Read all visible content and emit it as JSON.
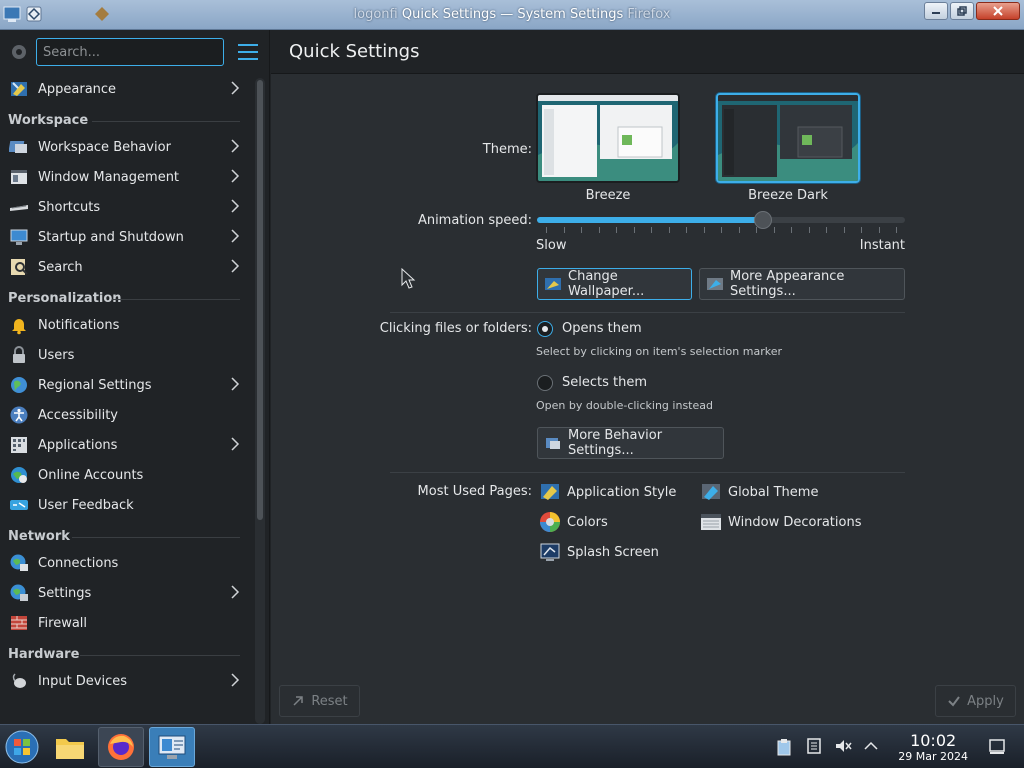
{
  "window": {
    "title_ghost_left": "logonfi",
    "title": "Quick Settings — System Settings",
    "title_ghost_right": "Firefox"
  },
  "sidebar": {
    "search_placeholder": "Search...",
    "appearance": "Appearance",
    "sections": {
      "workspace": "Workspace",
      "personalization": "Personalization",
      "network": "Network",
      "hardware": "Hardware"
    },
    "items": {
      "workspace_behavior": "Workspace Behavior",
      "window_management": "Window Management",
      "shortcuts": "Shortcuts",
      "startup_shutdown": "Startup and Shutdown",
      "search": "Search",
      "notifications": "Notifications",
      "users": "Users",
      "regional_settings": "Regional Settings",
      "accessibility": "Accessibility",
      "applications": "Applications",
      "online_accounts": "Online Accounts",
      "user_feedback": "User Feedback",
      "connections": "Connections",
      "settings": "Settings",
      "firewall": "Firewall",
      "input_devices": "Input Devices"
    }
  },
  "main": {
    "title": "Quick Settings",
    "theme_label": "Theme:",
    "themes": [
      "Breeze",
      "Breeze Dark"
    ],
    "selected_theme": "Breeze Dark",
    "animation_label": "Animation speed:",
    "animation_speed": 0.62,
    "slow_label": "Slow",
    "instant_label": "Instant",
    "change_wallpaper": "Change Wallpaper...",
    "more_appearance": "More Appearance Settings...",
    "clicking_label": "Clicking files or folders:",
    "opens_them": "Opens them",
    "opens_hint": "Select by clicking on item's selection marker",
    "selects_them": "Selects them",
    "selects_hint": "Open by double-clicking instead",
    "more_behavior": "More Behavior Settings...",
    "most_used_label": "Most Used Pages:",
    "most_used": {
      "application_style": "Application Style",
      "global_theme": "Global Theme",
      "colors": "Colors",
      "window_decorations": "Window Decorations",
      "splash_screen": "Splash Screen"
    },
    "reset": "Reset",
    "apply": "Apply"
  },
  "taskbar": {
    "time": "10:02",
    "date": "29 Mar 2024"
  },
  "colors": {
    "accent": "#3daee9",
    "background": "#202326",
    "panel": "#2a2e32"
  }
}
